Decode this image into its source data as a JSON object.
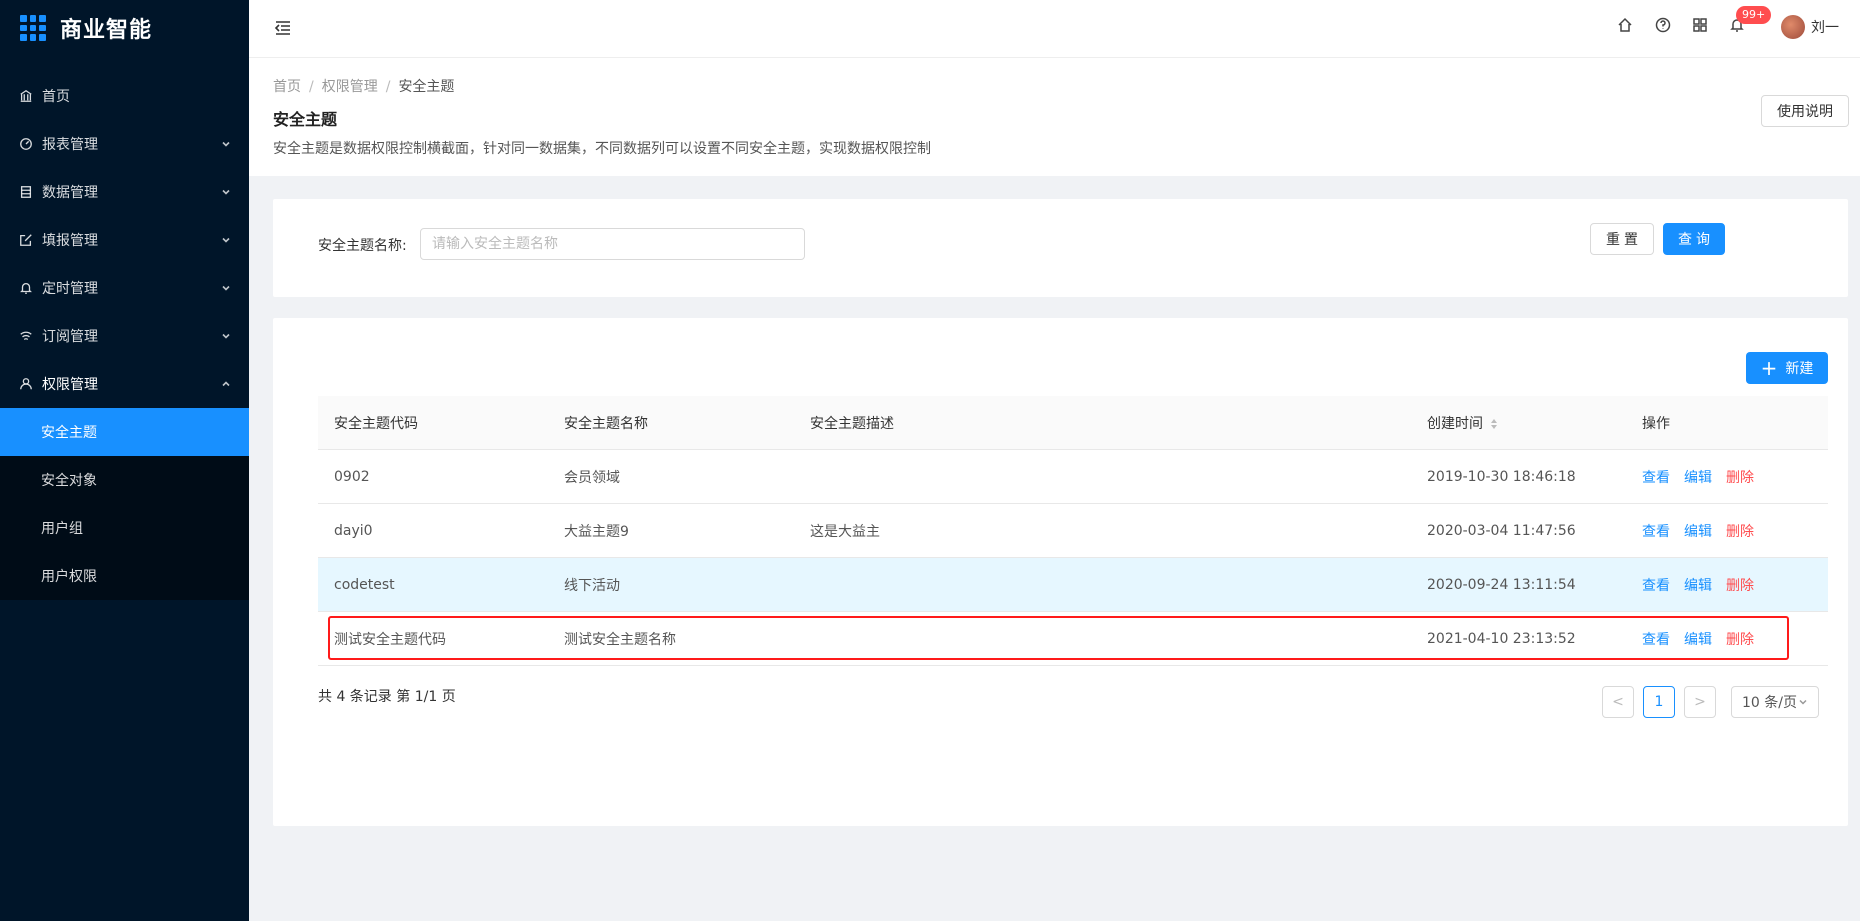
{
  "app": {
    "title": "商业智能"
  },
  "sidebar": {
    "items": [
      {
        "label": "首页",
        "icon": "bank-icon"
      },
      {
        "label": "报表管理",
        "icon": "dashboard-icon"
      },
      {
        "label": "数据管理",
        "icon": "database-icon"
      },
      {
        "label": "填报管理",
        "icon": "edit-icon"
      },
      {
        "label": "定时管理",
        "icon": "bell-icon"
      },
      {
        "label": "订阅管理",
        "icon": "wifi-icon"
      },
      {
        "label": "权限管理",
        "icon": "user-icon"
      }
    ],
    "sub_items": [
      {
        "label": "安全主题",
        "active": true
      },
      {
        "label": "安全对象"
      },
      {
        "label": "用户组"
      },
      {
        "label": "用户权限"
      }
    ]
  },
  "header": {
    "badge": "99+",
    "username": "刘一",
    "icons": [
      "home-icon",
      "question-icon",
      "apps-icon",
      "bell-icon"
    ]
  },
  "breadcrumb": {
    "home": "首页",
    "parent": "权限管理",
    "current": "安全主题"
  },
  "page": {
    "title": "安全主题",
    "description": "安全主题是数据权限控制横截面，针对同一数据集，不同数据列可以设置不同安全主题，实现数据权限控制",
    "help_button": "使用说明"
  },
  "search": {
    "label": "安全主题名称:",
    "placeholder": "请输入安全主题名称",
    "value": "",
    "reset_label": "重置",
    "query_label": "查询"
  },
  "table": {
    "new_button": "新建",
    "columns": [
      "安全主题代码",
      "安全主题名称",
      "安全主题描述",
      "创建时间",
      "操作"
    ],
    "rows": [
      {
        "code": "0902",
        "name": "会员领域",
        "desc": "",
        "time": "2019-10-30 18:46:18"
      },
      {
        "code": "dayi0",
        "name": "大益主题9",
        "desc": "这是大益主",
        "time": "2020-03-04 11:47:56"
      },
      {
        "code": "codetest",
        "name": "线下活动",
        "desc": "",
        "time": "2020-09-24 13:11:54",
        "highlighted": true
      },
      {
        "code": "测试安全主题代码",
        "name": "测试安全主题名称",
        "desc": "",
        "time": "2021-04-10 23:13:52",
        "boxed": true
      }
    ],
    "actions": {
      "view": "查看",
      "edit": "编辑",
      "delete": "删除"
    }
  },
  "pagination": {
    "summary": "共 4 条记录 第 1/1 页",
    "current_page": "1",
    "page_size": "10 条/页",
    "prev": "<",
    "next": ">"
  },
  "colors": {
    "primary": "#1890ff",
    "danger": "#ff4d4f",
    "sidebar_bg": "#001529"
  }
}
